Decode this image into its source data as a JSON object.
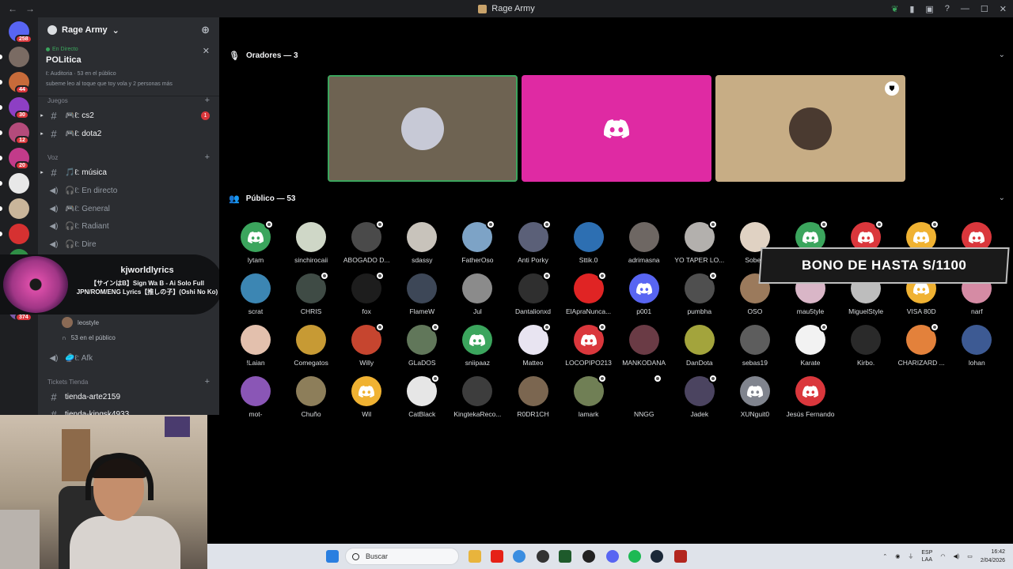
{
  "window": {
    "title": "Rage Army",
    "back_label": "←",
    "forward_label": "→"
  },
  "servers": [
    {
      "badge": "258",
      "color": "#5865f2"
    },
    {
      "badge": "",
      "color": "#7a6b63"
    },
    {
      "badge": "44",
      "color": "#c76b3a"
    },
    {
      "badge": "30",
      "color": "#8d3fc4"
    },
    {
      "badge": "12",
      "color": "#b44b7b"
    },
    {
      "badge": "20",
      "color": "#c23b8a"
    },
    {
      "badge": "",
      "color": "#e8e8e8"
    },
    {
      "badge": "",
      "color": "#c9b59a"
    },
    {
      "badge": "",
      "color": "#d63131"
    },
    {
      "badge": "50",
      "color": "#2f8f46"
    },
    {
      "badge": "",
      "color": "#b0343e"
    },
    {
      "badge": "374",
      "color": "#7b5ba8"
    }
  ],
  "sidebar": {
    "guild_name": "Rage Army",
    "live": {
      "tag": "En Directo",
      "title": "POLitica",
      "meta": "ℓ: Auditoria · 53 en el público",
      "sub": "subeme leo al toque que toy vola y 2 personas más"
    },
    "categories": {
      "juegos": "Juegos",
      "voz": "Voz",
      "tickets": "Tickets Tienda"
    },
    "channels": {
      "cs2": "🎮ℓ: cs2",
      "cs2_count": "1",
      "dota2": "🎮ℓ: dota2",
      "musica": "🎵ℓ: música",
      "en_directo": "🎧ℓ: En directo",
      "general": "🎮ℓ: General",
      "radiant": "🎧ℓ: Radiant",
      "dire": "🎧ℓ: Dire",
      "afk": "🥏ℓ: Afk",
      "tienda_arte": "tienda-arte2159",
      "tienda_kingsk": "tienda-kingsk4933"
    },
    "voice_sub": {
      "user": "leostyle",
      "audience": "53 en el público"
    }
  },
  "lyrics": {
    "user": "kjworldlyrics",
    "song": "【サインはB】Sign Wa B - Ai Solo Full JPN/ROM/ENG Lyrics【推しの子】(Oshi No Ko)"
  },
  "stage": {
    "speakers_header": "Oradores — 3",
    "audience_header": "Público — 53",
    "speakers": [
      {
        "bg": "#6e6352",
        "speaking": true,
        "avatar": "#c7c9d6",
        "mod": false
      },
      {
        "bg": "#df2aa3",
        "speaking": false,
        "avatar": "discord",
        "mod": false
      },
      {
        "bg": "#c7ad85",
        "speaking": false,
        "avatar": "#4a3a30",
        "mod": true
      }
    ],
    "audience": [
      {
        "name": "lytam",
        "color": "#3ba55d",
        "dc": true,
        "mini": true
      },
      {
        "name": "sinchirocaii",
        "color": "#cfd7c7",
        "dc": false,
        "mini": false
      },
      {
        "name": "ABOGADO D...",
        "color": "#4a4a4a",
        "dc": false,
        "mini": true
      },
      {
        "name": "sdassy",
        "color": "#c8c3bb",
        "dc": false,
        "mini": false
      },
      {
        "name": "FatherOso",
        "color": "#7da3c6",
        "dc": false,
        "mini": true
      },
      {
        "name": "Anti Porky",
        "color": "#5b6078",
        "dc": false,
        "mini": true
      },
      {
        "name": "Sttik.0",
        "color": "#2d6fb2",
        "dc": false,
        "mini": false
      },
      {
        "name": "adrimasna",
        "color": "#6e6763",
        "dc": false,
        "mini": false
      },
      {
        "name": "YO TAPER LO...",
        "color": "#b3b0ad",
        "dc": false,
        "mini": true
      },
      {
        "name": "Sobert",
        "color": "#e0d2c3",
        "dc": false,
        "mini": false
      },
      {
        "name": "",
        "color": "#3ba55d",
        "dc": true,
        "mini": true
      },
      {
        "name": "",
        "color": "#da373c",
        "dc": true,
        "mini": true
      },
      {
        "name": "",
        "color": "#f0b232",
        "dc": true,
        "mini": true
      },
      {
        "name": "",
        "color": "#da373c",
        "dc": true,
        "mini": false
      },
      {
        "name": "scrat",
        "color": "#3c86b3",
        "dc": false,
        "mini": false
      },
      {
        "name": "CHRIS",
        "color": "#3f4b45",
        "dc": false,
        "mini": true
      },
      {
        "name": "fox",
        "color": "#1d1d1d",
        "dc": false,
        "mini": true
      },
      {
        "name": "FlameW",
        "color": "#3d4757",
        "dc": false,
        "mini": false
      },
      {
        "name": "Jul",
        "color": "#8b8b8b",
        "dc": false,
        "mini": false
      },
      {
        "name": "Dantalionxd",
        "color": "#2f2f2f",
        "dc": false,
        "mini": true
      },
      {
        "name": "ElApraNunca...",
        "color": "#e02424",
        "dc": false,
        "mini": true
      },
      {
        "name": "p001",
        "color": "#5865f2",
        "dc": true,
        "mini": false
      },
      {
        "name": "pumbha",
        "color": "#4f4f4f",
        "dc": false,
        "mini": true
      },
      {
        "name": "OSO",
        "color": "#9b7a5c",
        "dc": false,
        "mini": false
      },
      {
        "name": "mau5tyle",
        "color": "#d9b6c7",
        "dc": false,
        "mini": false
      },
      {
        "name": "MiguelStyle",
        "color": "#bdbdbd",
        "dc": false,
        "mini": false
      },
      {
        "name": "VISA 80D",
        "color": "#f0b232",
        "dc": true,
        "mini": false
      },
      {
        "name": "narf",
        "color": "#d58ba4",
        "dc": false,
        "mini": false
      },
      {
        "name": "!Laian",
        "color": "#e3c0ad",
        "dc": false,
        "mini": false
      },
      {
        "name": "Comegatos",
        "color": "#c79a34",
        "dc": false,
        "mini": false
      },
      {
        "name": "Willy",
        "color": "#c6452f",
        "dc": false,
        "mini": true
      },
      {
        "name": "GLaDOS",
        "color": "#61775a",
        "dc": false,
        "mini": true
      },
      {
        "name": "sniipaaz",
        "color": "#3ba55d",
        "dc": true,
        "mini": false
      },
      {
        "name": "Matteo",
        "color": "#e8e4f1",
        "dc": false,
        "mini": true
      },
      {
        "name": "LOCOPIPO213",
        "color": "#da373c",
        "dc": true,
        "mini": true
      },
      {
        "name": "MANKODANA",
        "color": "#6a3b45",
        "dc": false,
        "mini": false
      },
      {
        "name": "DanDota",
        "color": "#a3a43c",
        "dc": false,
        "mini": false
      },
      {
        "name": "sebas19",
        "color": "#5d5d5d",
        "dc": false,
        "mini": false
      },
      {
        "name": "Karate",
        "color": "#f2f2f2",
        "dc": false,
        "mini": true
      },
      {
        "name": "Kirbo.",
        "color": "#2a2a2a",
        "dc": false,
        "mini": false
      },
      {
        "name": "CHARIZARD ...",
        "color": "#e3813b",
        "dc": false,
        "mini": true
      },
      {
        "name": "lohan",
        "color": "#3d5a93",
        "dc": false,
        "mini": false
      },
      {
        "name": "mot-",
        "color": "#8a56b6",
        "dc": false,
        "mini": false
      },
      {
        "name": "Chuño",
        "color": "#8d7e5a",
        "dc": false,
        "mini": false
      },
      {
        "name": "Wil",
        "color": "#f0b232",
        "dc": true,
        "mini": false
      },
      {
        "name": "CatBlack",
        "color": "#e6e6e6",
        "dc": false,
        "mini": true
      },
      {
        "name": "KingtekaReco...",
        "color": "#3d3d3d",
        "dc": false,
        "mini": false
      },
      {
        "name": "R0DR1CH",
        "color": "#7b6650",
        "dc": false,
        "mini": false
      },
      {
        "name": "lamark",
        "color": "#707f55",
        "dc": false,
        "mini": true
      },
      {
        "name": "NNGG",
        "color": "#000000",
        "dc": false,
        "mini": true
      },
      {
        "name": "Jadek",
        "color": "#4b4460",
        "dc": false,
        "mini": true
      },
      {
        "name": "XUNguit0",
        "color": "#80848e",
        "dc": true,
        "mini": false
      },
      {
        "name": "Jesús Fernando",
        "color": "#da373c",
        "dc": true,
        "mini": false
      }
    ]
  },
  "promo": {
    "text": "BONO DE HASTA S/1100"
  },
  "taskbar": {
    "search_placeholder": "Buscar",
    "lang_line1": "ESP",
    "lang_line2": "LAA",
    "time": "16:42",
    "date": "2/04/2026"
  }
}
